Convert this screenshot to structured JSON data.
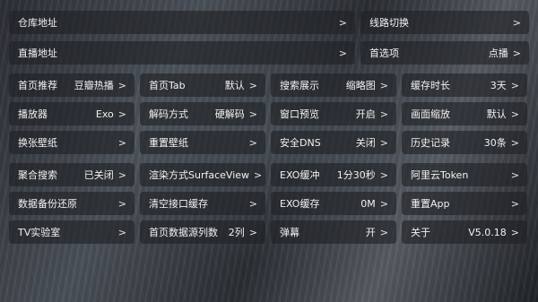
{
  "top_rows": [
    {
      "big": {
        "label": "仓库地址",
        "value": "",
        "arrow": ">"
      },
      "small": {
        "label": "线路切换",
        "value": "",
        "arrow": ">"
      }
    },
    {
      "big": {
        "label": "直播地址",
        "value": "",
        "arrow": ">"
      },
      "small": {
        "label": "首选项",
        "value": "点播",
        "arrow": ">"
      }
    }
  ],
  "grid": [
    [
      {
        "label": "首页推荐",
        "value": "豆瓣热播",
        "arrow": ">"
      },
      {
        "label": "首页Tab",
        "value": "默认",
        "arrow": ">"
      },
      {
        "label": "搜索展示",
        "value": "缩略图",
        "arrow": ">"
      },
      {
        "label": "缓存时长",
        "value": "3天",
        "arrow": ">"
      }
    ],
    [
      {
        "label": "播放器",
        "value": "Exo",
        "arrow": ">"
      },
      {
        "label": "解码方式",
        "value": "硬解码",
        "arrow": ">"
      },
      {
        "label": "窗口预览",
        "value": "开启",
        "arrow": ">"
      },
      {
        "label": "画面缩放",
        "value": "默认",
        "arrow": ">"
      }
    ],
    [
      {
        "label": "换张壁纸",
        "value": "",
        "arrow": ">"
      },
      {
        "label": "重置壁纸",
        "value": "",
        "arrow": ">"
      },
      {
        "label": "安全DNS",
        "value": "关闭",
        "arrow": ">"
      },
      {
        "label": "历史记录",
        "value": "30条",
        "arrow": ">"
      }
    ],
    [
      {
        "label": "聚合搜索",
        "value": "已关闭",
        "arrow": ">"
      },
      {
        "label": "渲染方式",
        "value": "SurfaceView",
        "arrow": ">"
      },
      {
        "label": "EXO缓冲",
        "value": "1分30秒",
        "arrow": ">"
      },
      {
        "label": "阿里云Token",
        "value": "",
        "arrow": ">"
      }
    ],
    [
      {
        "label": "数据备份还原",
        "value": "",
        "arrow": ">"
      },
      {
        "label": "清空接口缓存",
        "value": "",
        "arrow": ">"
      },
      {
        "label": "EXO缓存",
        "value": "0M",
        "arrow": ">"
      },
      {
        "label": "重置App",
        "value": "",
        "arrow": ">"
      }
    ],
    [
      {
        "label": "TV实验室",
        "value": "",
        "arrow": ">"
      },
      {
        "label": "首页数据源列数",
        "value": "2列",
        "arrow": ">"
      },
      {
        "label": "弹幕",
        "value": "开",
        "arrow": ">"
      },
      {
        "label": "关于",
        "value": "V5.0.18",
        "arrow": ">"
      }
    ]
  ]
}
